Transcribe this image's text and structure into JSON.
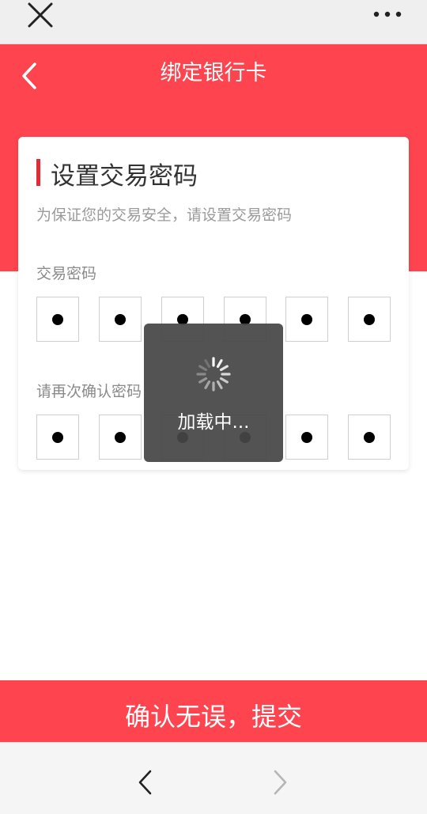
{
  "topbar": {
    "close_icon": "close-icon",
    "more_icon": "more-horizontal-icon"
  },
  "header": {
    "back_icon": "chevron-left-icon",
    "title": "绑定银行卡",
    "background_color": "#fe444f"
  },
  "card": {
    "heading": "设置交易密码",
    "subtitle": "为保证您的交易安全，请设置交易密码",
    "password_label": "交易密码",
    "confirm_label": "请再次确认密码",
    "password_digits_filled": 6,
    "confirm_digits_filled": 6,
    "accent_color": "#e02c37"
  },
  "toast": {
    "text": "加载中...",
    "icon": "spinner-icon"
  },
  "submit": {
    "label": "确认无误，提交",
    "color": "#fe444f"
  },
  "bottom_nav": {
    "back_icon": "chevron-left-icon",
    "forward_icon": "chevron-right-icon"
  }
}
